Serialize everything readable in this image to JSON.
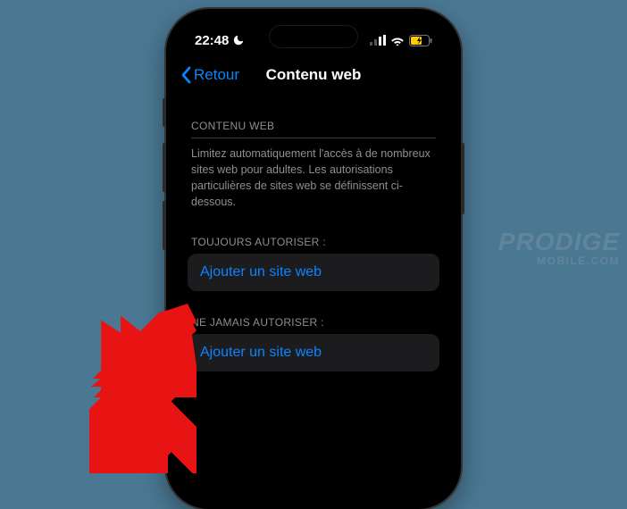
{
  "statusBar": {
    "time": "22:48"
  },
  "nav": {
    "back": "Retour",
    "title": "Contenu web"
  },
  "sections": {
    "webContent": {
      "header": "CONTENU WEB",
      "description": "Limitez automatiquement l'accès à de nombreux sites web pour adultes. Les autorisations particulières de sites web se définissent ci-dessous."
    },
    "alwaysAllow": {
      "header": "TOUJOURS AUTORISER :",
      "addLabel": "Ajouter un site web"
    },
    "neverAllow": {
      "header": "NE JAMAIS AUTORISER :",
      "addLabel": "Ajouter un site web"
    }
  },
  "watermark": {
    "line1": "PRODIGE",
    "line2": "MOBILE.COM"
  }
}
